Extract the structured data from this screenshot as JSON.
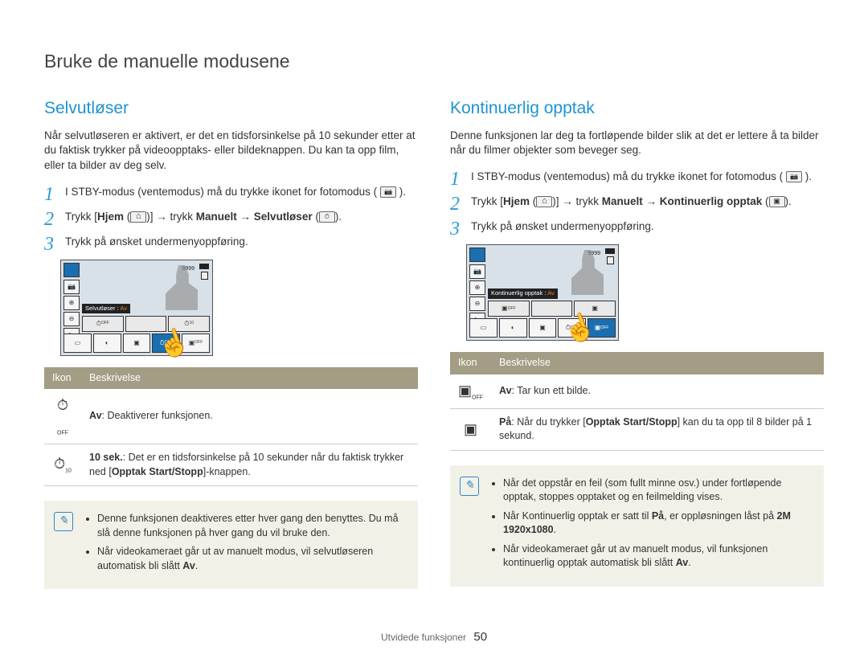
{
  "page_title": "Bruke de manuelle modusene",
  "left": {
    "heading": "Selvutløser",
    "intro": "Når selvutløseren er aktivert, er det en tidsforsinkelse på 10 sekunder etter at du faktisk trykker på videoopptaks- eller bildeknappen. Du kan ta opp film, eller ta bilder av deg selv.",
    "step1": "I STBY-modus (ventemodus) må du trykke ikonet for fotomodus (",
    "step1_end": ").",
    "step2_a": "Trykk [",
    "step2_hjem": "Hjem",
    "step2_b": " (",
    "step2_c": ")] → trykk ",
    "step2_manuelt": "Manuelt",
    "step2_d": " → ",
    "step2_selv": "Selvutløser",
    "step2_e": " (",
    "step2_f": ").",
    "step3": "Trykk på ønsket undermenyoppføring.",
    "screenshot": {
      "counter": "9999",
      "label_prefix": "Selvutløser : ",
      "label_value": "Av"
    },
    "table": {
      "h1": "Ikon",
      "h2": "Beskrivelse",
      "r1_bold": "Av",
      "r1_rest": ": Deaktiverer funksjonen.",
      "r2_bold": "10 sek.",
      "r2_rest": ": Det er en tidsforsinkelse på 10 sekunder når du faktisk trykker ned [",
      "r2_bold2": "Opptak Start/Stopp",
      "r2_rest2": "]-knappen."
    },
    "notes": {
      "n1": "Denne funksjonen deaktiveres etter hver gang den benyttes. Du må slå denne funksjonen på hver gang du vil bruke den.",
      "n2_a": "Når videokameraet går ut av manuelt modus, vil selvutløseren automatisk bli slått ",
      "n2_bold": "Av",
      "n2_b": "."
    }
  },
  "right": {
    "heading": "Kontinuerlig opptak",
    "intro": "Denne funksjonen lar deg ta fortløpende bilder slik at det er lettere å ta bilder når du filmer objekter som beveger seg.",
    "step1": "I STBY-modus (ventemodus) må du trykke ikonet for fotomodus (",
    "step1_end": ").",
    "step2_a": "Trykk [",
    "step2_hjem": "Hjem",
    "step2_b": " (",
    "step2_c": ")] → trykk ",
    "step2_manuelt": "Manuelt",
    "step2_d": " → ",
    "step2_kont": "Kontinuerlig opptak",
    "step2_e": " (",
    "step2_f": ").",
    "step3": "Trykk på ønsket undermenyoppføring.",
    "screenshot": {
      "counter": "9999",
      "label_prefix": "Kontinuerlig opptak : ",
      "label_value": "Av"
    },
    "table": {
      "h1": "Ikon",
      "h2": "Beskrivelse",
      "r1_bold": "Av",
      "r1_rest": ": Tar kun ett bilde.",
      "r2_bold": "På",
      "r2_rest": ": Når du trykker [",
      "r2_bold2": "Opptak Start/Stopp",
      "r2_rest2": "] kan du ta opp til 8 bilder på 1 sekund."
    },
    "notes": {
      "n1": "Når det oppstår en feil (som fullt minne osv.) under fortløpende opptak, stoppes opptaket og en feilmelding vises.",
      "n2_a": "Når Kontinuerlig opptak er satt til ",
      "n2_bold1": "På",
      "n2_b": ", er oppløsningen låst på ",
      "n2_bold2": "2M 1920x1080",
      "n2_c": ".",
      "n3_a": "Når videokameraet går ut av manuelt modus, vil funksjonen kontinuerlig opptak automatisk bli slått ",
      "n3_bold": "Av",
      "n3_b": "."
    }
  },
  "footer": {
    "section": "Utvidede funksjoner",
    "page": "50"
  }
}
